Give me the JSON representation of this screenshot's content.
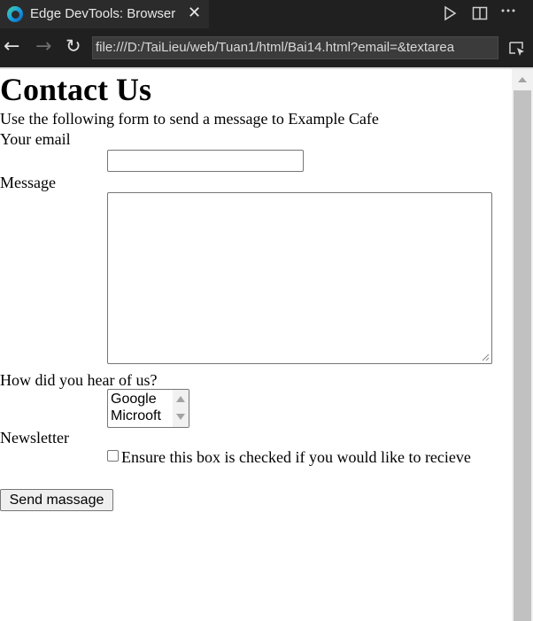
{
  "browser": {
    "tab_title": "Edge DevTools: Browser",
    "tab_close_glyph": "✕",
    "url": "file:///D:/TaiLieu/web/Tuan1/html/Bai14.html?email=&textarea",
    "icons": [
      "edge-logo-icon",
      "close-icon",
      "play-icon",
      "split-view-icon",
      "more-icon",
      "back-arrow-icon",
      "forward-arrow-icon",
      "reload-icon",
      "inspect-icon"
    ]
  },
  "page": {
    "heading": "Contact Us",
    "intro": "Use the following form to send a message to Example Cafe",
    "email_label": "Your email",
    "email_value": "",
    "message_label": "Message",
    "message_value": "",
    "hear_label": "How did you hear of us?",
    "hear_options": [
      "Google",
      "Microoft"
    ],
    "newsletter_label": "Newsletter",
    "newsletter_checked": false,
    "newsletter_text": "Ensure this box is checked if you would like to recieve",
    "submit_label": "Send massage"
  }
}
